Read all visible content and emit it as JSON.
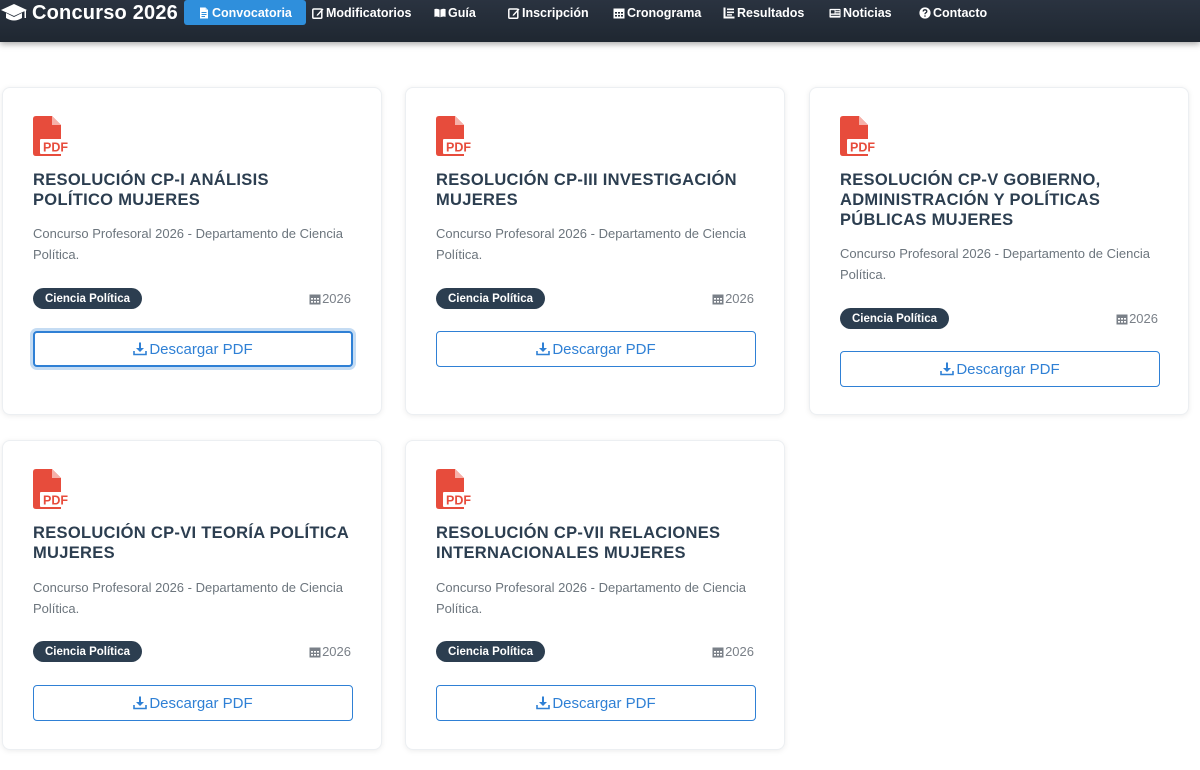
{
  "app": {
    "brand": "Concurso 2026",
    "colors": {
      "navbar_bg": "#232c37",
      "nav_active": "#2f8fdc",
      "card_title": "#2c3e50",
      "badge_bg": "#2c3e50",
      "button_accent": "#2f80d5",
      "pdf_icon": "#e74c3c"
    }
  },
  "nav": {
    "items": [
      {
        "label": "Convocatoria",
        "icon": "file-document-icon",
        "active": true
      },
      {
        "label": "Modificatorios",
        "icon": "edit-square-icon",
        "active": false
      },
      {
        "label": "Guía",
        "icon": "book-open-icon",
        "active": false
      },
      {
        "label": "Inscripción",
        "icon": "edit-square-icon",
        "active": false
      },
      {
        "label": "Cronograma",
        "icon": "calendar-icon",
        "active": false
      },
      {
        "label": "Resultados",
        "icon": "list-icon",
        "active": false
      },
      {
        "label": "Noticias",
        "icon": "newspaper-icon",
        "active": false
      },
      {
        "label": "Contacto",
        "icon": "question-circle-icon",
        "active": false
      }
    ]
  },
  "cards": [
    {
      "icon": "pdf-file-icon",
      "title": "RESOLUCIÓN CP-I ANÁLISIS POLÍTICO MUJERES",
      "description": "Concurso Profesoral 2026 - Departamento de Ciencia Política.",
      "badge": "Ciencia Política",
      "year": "2026",
      "button_label": "Descargar PDF",
      "focused": true
    },
    {
      "icon": "pdf-file-icon",
      "title": "RESOLUCIÓN CP-III INVESTIGACIÓN MUJERES",
      "description": "Concurso Profesoral 2026 - Departamento de Ciencia Política.",
      "badge": "Ciencia Política",
      "year": "2026",
      "button_label": "Descargar PDF",
      "focused": false
    },
    {
      "icon": "pdf-file-icon",
      "title": "RESOLUCIÓN CP-V GOBIERNO, ADMINISTRACIÓN Y POLÍTICAS PÚBLICAS MUJERES",
      "description": "Concurso Profesoral 2026 - Departamento de Ciencia Política.",
      "badge": "Ciencia Política",
      "year": "2026",
      "button_label": "Descargar PDF",
      "focused": false
    },
    {
      "icon": "pdf-file-icon",
      "title": "RESOLUCIÓN CP-VI TEORÍA POLÍTICA MUJERES",
      "description": "Concurso Profesoral 2026 - Departamento de Ciencia Política.",
      "badge": "Ciencia Política",
      "year": "2026",
      "button_label": "Descargar PDF",
      "focused": false
    },
    {
      "icon": "pdf-file-icon",
      "title": "RESOLUCIÓN CP-VII RELACIONES INTERNACIONALES MUJERES",
      "description": "Concurso Profesoral 2026 - Departamento de Ciencia Política.",
      "badge": "Ciencia Política",
      "year": "2026",
      "button_label": "Descargar PDF",
      "focused": false
    }
  ]
}
